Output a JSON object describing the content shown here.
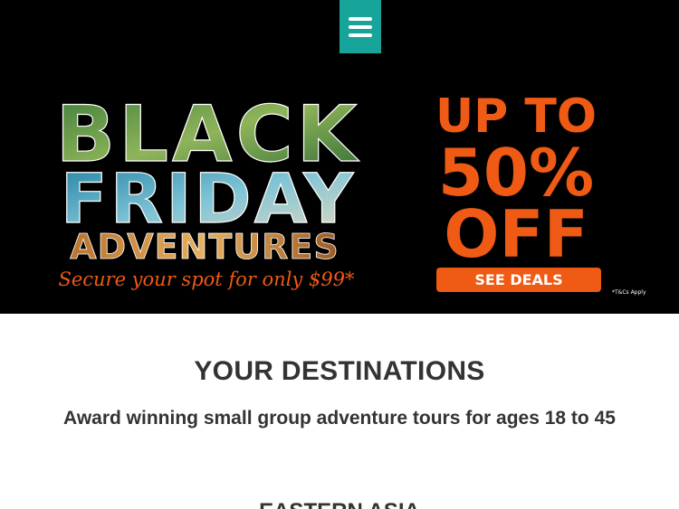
{
  "header": {
    "menu_icon": "hamburger-menu-icon",
    "menu_color": "#17a59b"
  },
  "banner": {
    "line1": "BLACK",
    "line2": "FRIDAY",
    "line3": "ADVENTURES",
    "tagline": "Secure your spot for only $99*",
    "offer_line1": "UP TO",
    "offer_line2": "50%",
    "offer_line3": "OFF",
    "cta_label": "SEE DEALS",
    "disclaimer": "*T&Cs Apply",
    "accent_color": "#ef5a14"
  },
  "main": {
    "title": "YOUR DESTINATIONS",
    "subtitle": "Award winning small group adventure tours for ages 18 to 45",
    "region_heading": "EASTERN ASIA"
  }
}
